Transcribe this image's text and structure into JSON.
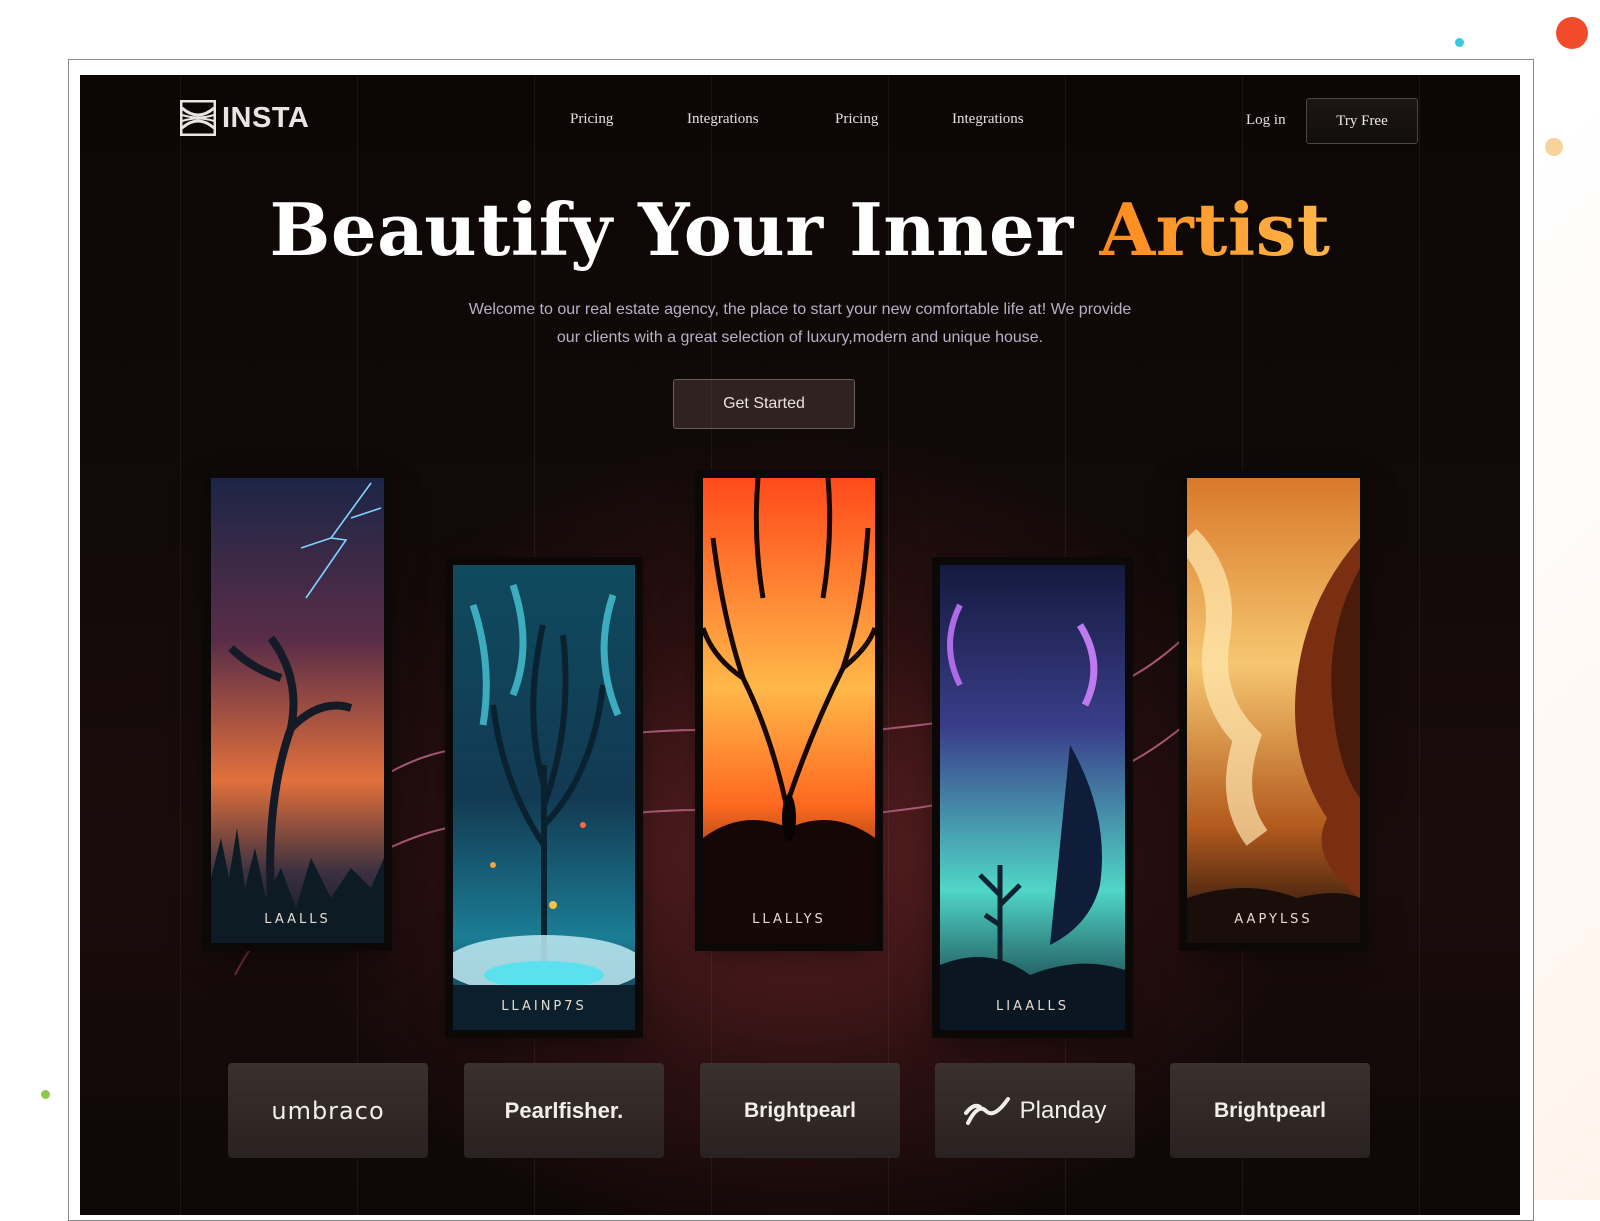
{
  "nav": {
    "logo_text": "INSTA",
    "links": [
      "Pricing",
      "Integrations",
      "Pricing",
      "Integrations"
    ],
    "login": "Log in",
    "try_free": "Try Free"
  },
  "hero": {
    "title_main": "Beautify Your Inner",
    "title_accent": "Artist",
    "subtitle_line1": "Welcome to our real estate agency, the place to start your new comfortable life at! We provide",
    "subtitle_line2": "our clients with a great selection of luxury,modern and unique house.",
    "cta": "Get Started"
  },
  "cards": [
    {
      "label": "LAALLS",
      "theme": "storm-sunset",
      "colors": [
        "#1a2240",
        "#e26a3a"
      ]
    },
    {
      "label": "LLAINP7S",
      "theme": "teal-tree",
      "colors": [
        "#0f3d50",
        "#3fc7d6"
      ]
    },
    {
      "label": "LLALLYS",
      "theme": "fire-tree",
      "colors": [
        "#ff5a1f",
        "#ffb347"
      ]
    },
    {
      "label": "LIAALLS",
      "theme": "violet-spirit",
      "colors": [
        "#1b1f4a",
        "#5fe0d0"
      ]
    },
    {
      "label": "AAPYLSS",
      "theme": "amber-cliff",
      "colors": [
        "#e08a2a",
        "#ffd58a"
      ]
    }
  ],
  "brands": [
    "umbraco",
    "Pearlfisher.",
    "Brightpearl",
    "Planday",
    "Brightpearl"
  ],
  "colors": {
    "accent": "#ff8a1c",
    "background": "#0c0605"
  }
}
